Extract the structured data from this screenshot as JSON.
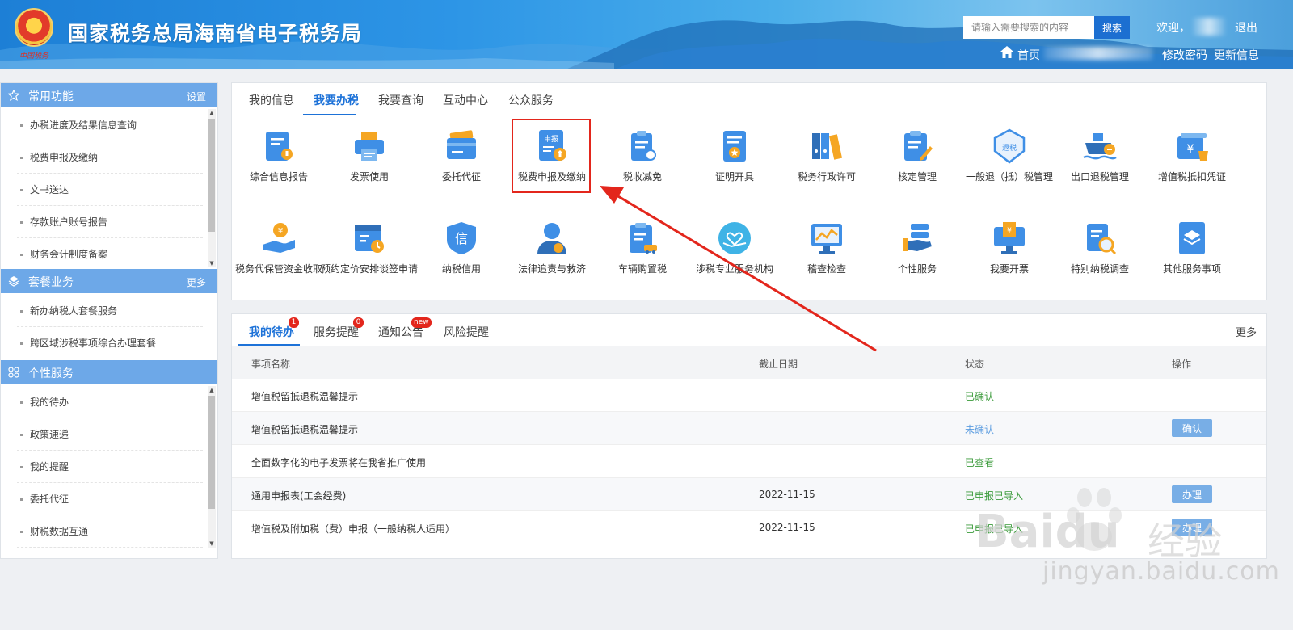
{
  "header": {
    "title": "国家税务总局海南省电子税务局",
    "emblem_caption": "中国税务",
    "search_placeholder": "请输入需要搜索的内容",
    "search_button": "搜索",
    "welcome": "欢迎，",
    "logout": "退出",
    "home": "首页",
    "change_password": "修改密码",
    "update_info": "更新信息"
  },
  "sidebar": {
    "sections": [
      {
        "title": "常用功能",
        "action": "设置",
        "icon": "star-icon",
        "items": [
          "办税进度及结果信息查询",
          "税费申报及缴纳",
          "文书送达",
          "存款账户账号报告",
          "财务会计制度备案"
        ]
      },
      {
        "title": "套餐业务",
        "action": "更多",
        "icon": "layers-icon",
        "items": [
          "新办纳税人套餐服务",
          "跨区域涉税事项综合办理套餐"
        ]
      },
      {
        "title": "个性服务",
        "action": "",
        "icon": "grid-icon",
        "items": [
          "我的待办",
          "政策速递",
          "我的提醒",
          "委托代征",
          "财税数据互通"
        ]
      }
    ]
  },
  "service_tabs": [
    "我的信息",
    "我要办税",
    "我要查询",
    "互动中心",
    "公众服务"
  ],
  "service_icons": {
    "icon_badges": {
      "declare": "申报",
      "refund": "退税",
      "credit": "信"
    },
    "row1": [
      "综合信息报告",
      "发票使用",
      "委托代征",
      "税费申报及缴纳",
      "税收减免",
      "证明开具",
      "税务行政许可",
      "核定管理",
      "一般退（抵）税管理",
      "出口退税管理",
      "增值税抵扣凭证"
    ],
    "row2": [
      "税务代保管资金收取",
      "预约定价安排谈签申请",
      "纳税信用",
      "法律追责与救济",
      "车辆购置税",
      "涉税专业服务机构",
      "稽查检查",
      "个性服务",
      "我要开票",
      "特别纳税调查",
      "其他服务事项"
    ]
  },
  "todo": {
    "tabs": [
      {
        "label": "我的待办",
        "badge": "1"
      },
      {
        "label": "服务提醒",
        "badge": "0"
      },
      {
        "label": "通知公告",
        "badge": "new"
      },
      {
        "label": "风险提醒",
        "badge": ""
      }
    ],
    "more": "更多",
    "columns": [
      "事项名称",
      "截止日期",
      "状态",
      "操作"
    ],
    "rows": [
      {
        "name": "增值税留抵退税温馨提示",
        "date": "",
        "status": "已确认",
        "action": ""
      },
      {
        "name": "增值税留抵退税温馨提示",
        "date": "",
        "status": "未确认",
        "action": "确认"
      },
      {
        "name": "全面数字化的电子发票将在我省推广使用",
        "date": "",
        "status": "已查看",
        "action": ""
      },
      {
        "name": "通用申报表(工会经费)",
        "date": "2022-11-15",
        "status": "已申报已导入",
        "action": "办理"
      },
      {
        "name": "增值税及附加税（费）申报（一般纳税人适用）",
        "date": "2022-11-15",
        "status": "已申报已导入",
        "action": "办理"
      }
    ]
  },
  "watermark": {
    "brand": "Baidu",
    "brand_cn": "经验",
    "url": "jingyan.baidu.com"
  },
  "colors": {
    "primary": "#1d72d8",
    "sidebar_head": "#6da8e8",
    "highlight": "#e3261c",
    "status_green": "#3a9a3a",
    "status_blue": "#5c9de0"
  }
}
